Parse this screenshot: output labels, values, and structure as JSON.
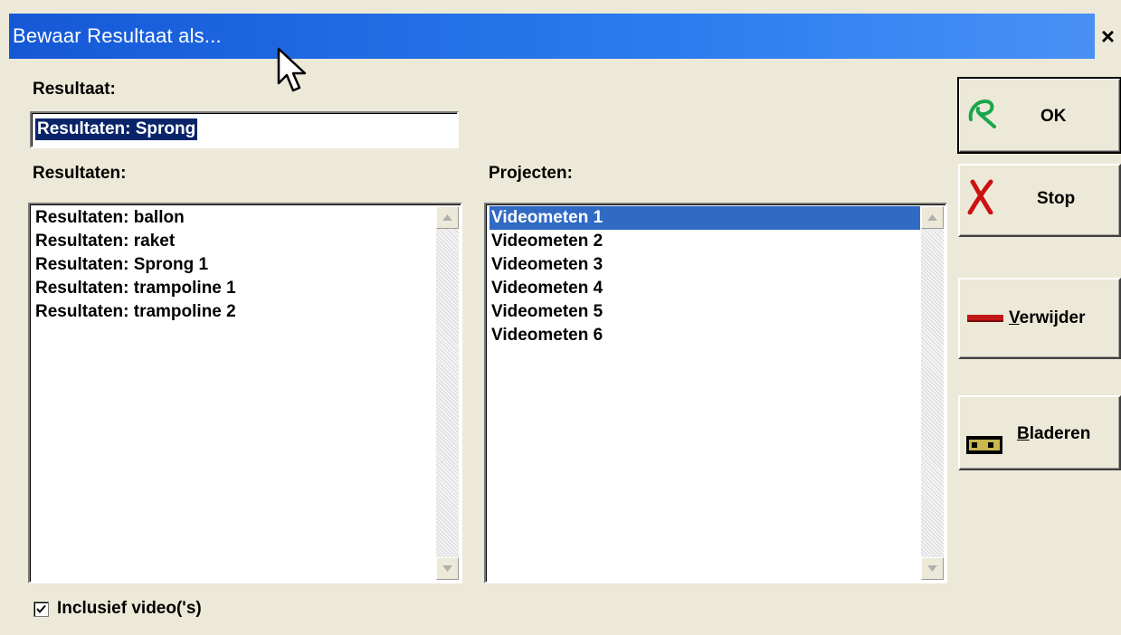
{
  "window": {
    "title": "Bewaar Resultaat als...",
    "close_glyph": "×"
  },
  "result_field": {
    "label": "Resultaat:",
    "value": "Resultaten: Sprong"
  },
  "results_list": {
    "label": "Resultaten:",
    "items": [
      "Resultaten: ballon",
      "Resultaten: raket",
      "Resultaten: Sprong 1",
      "Resultaten: trampoline 1",
      "Resultaten: trampoline 2"
    ]
  },
  "projects_list": {
    "label": "Projecten:",
    "selected_index": 0,
    "items": [
      "Videometen 1",
      "Videometen 2",
      "Videometen 3",
      "Videometen 4",
      "Videometen 5",
      "Videometen 6"
    ]
  },
  "buttons": {
    "ok": {
      "label": "OK",
      "icon": "green-check-icon"
    },
    "stop": {
      "label": "Stop",
      "icon": "red-x-icon"
    },
    "delete": {
      "label_first": "V",
      "label_rest": "erwijder",
      "icon": "red-bar-icon"
    },
    "browse": {
      "label_first": "B",
      "label_rest": "laderen",
      "icon": "folder-icon"
    }
  },
  "include_video": {
    "label": "Inclusief video('s)",
    "checked": true
  },
  "colors": {
    "title_bar": "#1f6ce6",
    "selection": "#316ac5",
    "face": "#ece9d8"
  }
}
